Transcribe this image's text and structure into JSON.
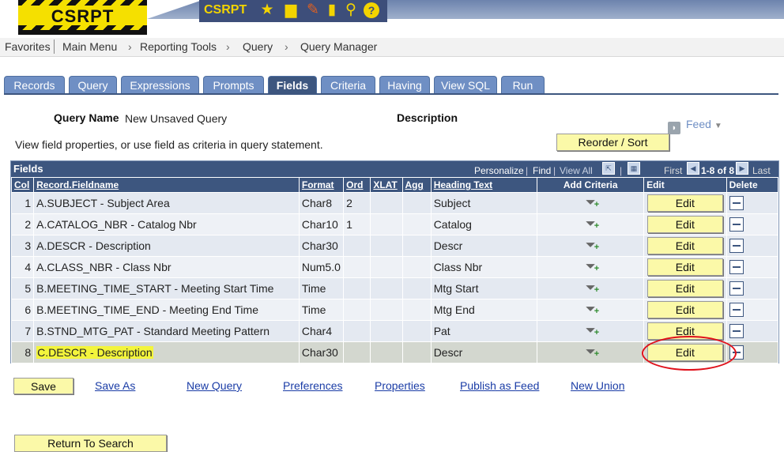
{
  "banner": {
    "logo_text": "CSRPT",
    "app_name": "CSRPT",
    "icons": [
      "star-icon",
      "folder-icon",
      "pencil-icon",
      "document-icon",
      "search-icon",
      "help-icon"
    ]
  },
  "breadcrumb": {
    "items": [
      "Favorites",
      "Main Menu",
      "Reporting Tools",
      "Query",
      "Query Manager"
    ]
  },
  "tabs": [
    "Records",
    "Query",
    "Expressions",
    "Prompts",
    "Fields",
    "Criteria",
    "Having",
    "View SQL",
    "Run"
  ],
  "active_tab": "Fields",
  "header": {
    "query_name_label": "Query Name",
    "query_name_value": "New Unsaved Query",
    "description_label": "Description",
    "instructions": "View field properties, or use field as criteria in query statement.",
    "feed_label": "Feed",
    "reorder_label": "Reorder / Sort"
  },
  "grid": {
    "title": "Fields",
    "personalize": "Personalize",
    "find": "Find",
    "view_all": "View All",
    "first": "First",
    "range": "1-8 of 8",
    "last": "Last",
    "columns": [
      "Col",
      "Record.Fieldname",
      "Format",
      "Ord",
      "XLAT",
      "Agg",
      "Heading Text",
      "Add Criteria",
      "Edit",
      "Delete"
    ],
    "edit_label": "Edit",
    "rows": [
      {
        "col": "1",
        "field": "A.SUBJECT - Subject Area",
        "format": "Char8",
        "ord": "2",
        "xlat": "",
        "agg": "",
        "heading": "Subject"
      },
      {
        "col": "2",
        "field": "A.CATALOG_NBR - Catalog Nbr",
        "format": "Char10",
        "ord": "1",
        "xlat": "",
        "agg": "",
        "heading": "Catalog"
      },
      {
        "col": "3",
        "field": "A.DESCR - Description",
        "format": "Char30",
        "ord": "",
        "xlat": "",
        "agg": "",
        "heading": "Descr"
      },
      {
        "col": "4",
        "field": "A.CLASS_NBR - Class Nbr",
        "format": "Num5.0",
        "ord": "",
        "xlat": "",
        "agg": "",
        "heading": "Class Nbr"
      },
      {
        "col": "5",
        "field": "B.MEETING_TIME_START - Meeting Start Time",
        "format": "Time",
        "ord": "",
        "xlat": "",
        "agg": "",
        "heading": "Mtg Start"
      },
      {
        "col": "6",
        "field": "B.MEETING_TIME_END - Meeting End Time",
        "format": "Time",
        "ord": "",
        "xlat": "",
        "agg": "",
        "heading": "Mtg End"
      },
      {
        "col": "7",
        "field": "B.STND_MTG_PAT - Standard Meeting Pattern",
        "format": "Char4",
        "ord": "",
        "xlat": "",
        "agg": "",
        "heading": "Pat"
      },
      {
        "col": "8",
        "field": "C.DESCR - Description",
        "format": "Char30",
        "ord": "",
        "xlat": "",
        "agg": "",
        "heading": "Descr"
      }
    ]
  },
  "actions": {
    "save": "Save",
    "links": [
      "Save As",
      "New Query",
      "Preferences",
      "Properties",
      "Publish as Feed",
      "New Union"
    ],
    "return": "Return To Search"
  },
  "colors": {
    "header_blue": "#3d567f",
    "tab_blue": "#6f8fc4",
    "button_yellow": "#fbf9a8",
    "annotation_red": "#e0101a",
    "highlight_yellow": "#f3f53c"
  }
}
